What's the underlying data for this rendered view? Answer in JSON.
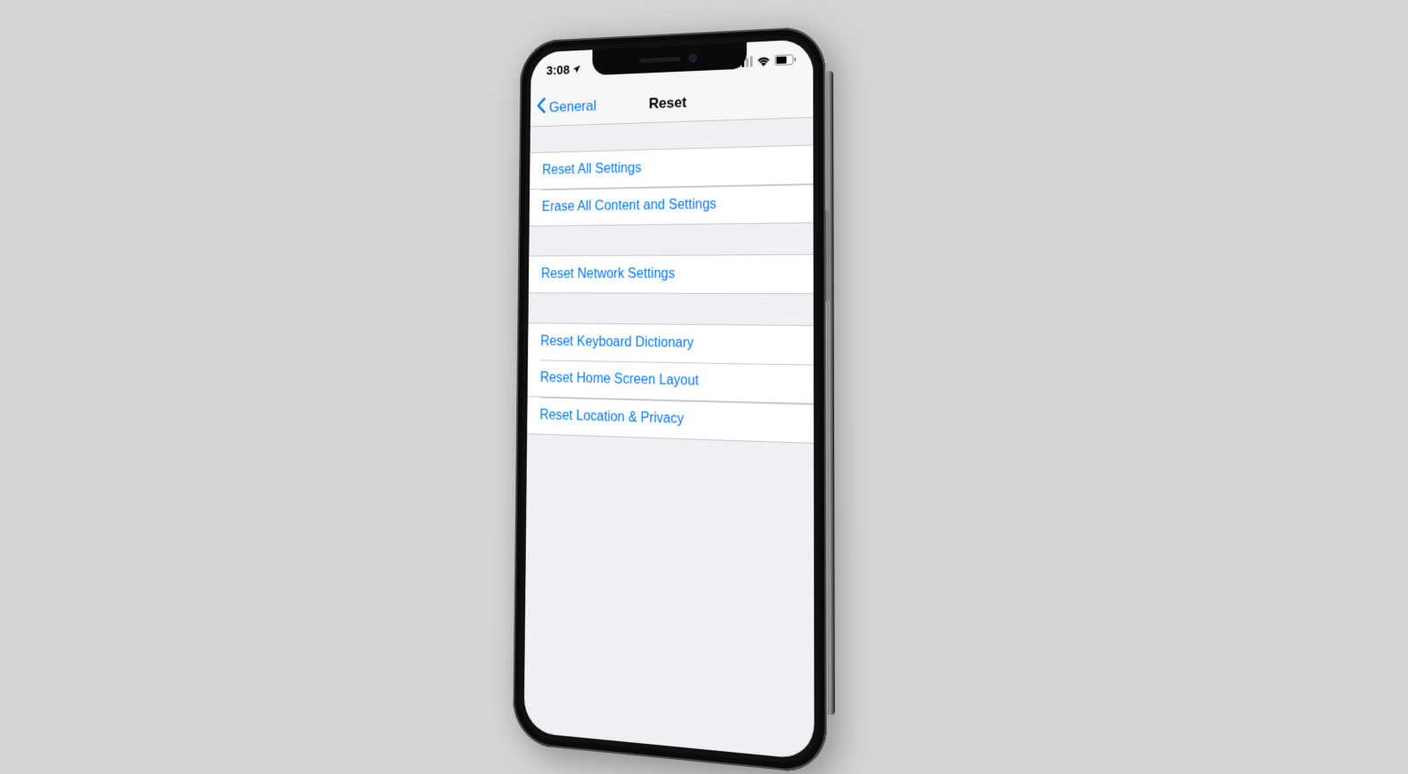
{
  "status_bar": {
    "time": "3:08",
    "location_icon": "location-arrow",
    "signal_icon": "cellular-signal",
    "wifi_icon": "wifi",
    "battery_icon": "battery"
  },
  "nav": {
    "back_label": "General",
    "title": "Reset"
  },
  "groups": [
    {
      "items": [
        {
          "label": "Reset All Settings"
        },
        {
          "label": "Erase All Content and Settings"
        }
      ]
    },
    {
      "items": [
        {
          "label": "Reset Network Settings"
        }
      ]
    },
    {
      "items": [
        {
          "label": "Reset Keyboard Dictionary"
        },
        {
          "label": "Reset Home Screen Layout"
        },
        {
          "label": "Reset Location & Privacy"
        }
      ]
    }
  ],
  "colors": {
    "link": "#007aff",
    "bg": "#efeff4",
    "cell": "#ffffff",
    "separator": "#c8c7cc"
  }
}
